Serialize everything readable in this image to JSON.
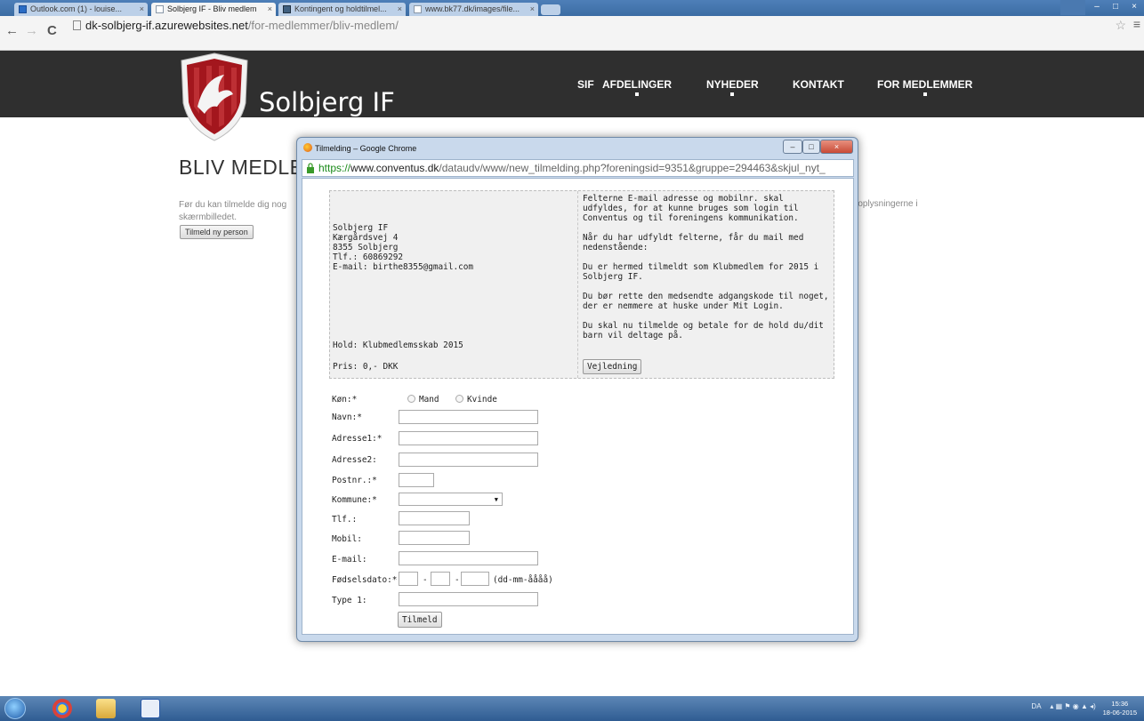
{
  "browser": {
    "tabs": [
      {
        "label": "Outlook.com (1) - louise..."
      },
      {
        "label": "Solbjerg IF - Bliv medlem"
      },
      {
        "label": "Kontingent og holdtilmel..."
      },
      {
        "label": "www.bk77.dk/images/file..."
      }
    ],
    "url_host": "dk-solbjerg-if.azurewebsites.net",
    "url_path": "/for-medlemmer/bliv-medlem/"
  },
  "site": {
    "logo_text": "Solbjerg IF",
    "nav": [
      "SIF",
      "AFDELINGER",
      "NYHEDER",
      "KONTAKT",
      "FOR MEDLEMMER"
    ],
    "page_title": "BLIV MEDLEM",
    "intro_line1": "Før du kan tilmelde dig nog",
    "intro_line2": "skærmbilledet.",
    "intro_right": "e oplysningerne i",
    "register_button": "Tilmeld ny person"
  },
  "popup": {
    "title": "Tilmelding – Google Chrome",
    "url_scheme": "https://",
    "url_host": "www.conventus.dk",
    "url_path": "/dataudv/www/new_tilmelding.php?foreningsid=9351&gruppe=294463&skjul_nyt_",
    "club": {
      "name": "Solbjerg IF",
      "address": "Kærgårdsvej 4",
      "city": "8355 Solbjerg",
      "phone": "Tlf.: 60869292",
      "email": "E-mail: birthe8355@gmail.com",
      "hold": "Hold: Klubmedlemsskab 2015",
      "price": "Pris: 0,- DKK"
    },
    "info_paragraphs": [
      "Felterne E-mail adresse og mobilnr. skal udfyldes, for at kunne bruges som login til Conventus og til foreningens kommunikation.",
      "Når du har udfyldt felterne, får du mail med nedenstående:",
      "Du er hermed tilmeldt som Klubmedlem for 2015 i Solbjerg IF.",
      "Du bør rette den medsendte adgangskode til noget, der er nemmere at huske under Mit Login.",
      "Du skal nu tilmelde og betale for de hold du/dit barn vil deltage på."
    ],
    "guide_button": "Vejledning",
    "form": {
      "gender_label": "Køn:*",
      "gender_male": "Mand",
      "gender_female": "Kvinde",
      "name_label": "Navn:*",
      "address1_label": "Adresse1:*",
      "address2_label": "Adresse2:",
      "postal_label": "Postnr.:*",
      "municipality_label": "Kommune:*",
      "phone_label": "Tlf.:",
      "mobile_label": "Mobil:",
      "email_label": "E-mail:",
      "birthdate_label": "Fødselsdato:*",
      "date_sep": "-",
      "birthdate_hint": "(dd-mm-åååå)",
      "type1_label": "Type 1:",
      "submit": "Tilmeld"
    }
  },
  "taskbar": {
    "tray_lang": "DA",
    "time": "15:36",
    "date": "18-06-2015"
  }
}
